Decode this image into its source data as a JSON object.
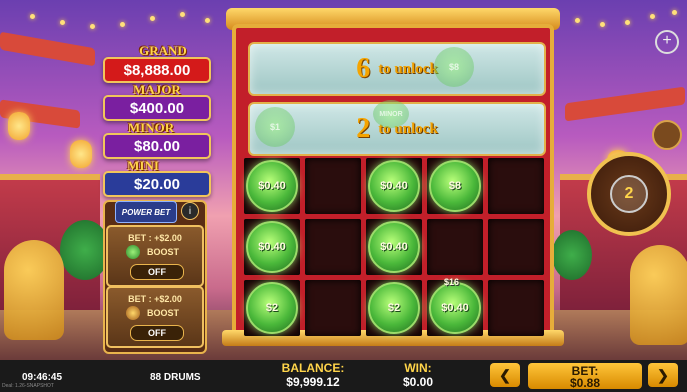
{
  "jackpots": [
    {
      "name": "GRAND",
      "amount": "$8,888.00",
      "color": "#d41a1a"
    },
    {
      "name": "MAJOR",
      "amount": "$400.00",
      "color": "#7a1fa0"
    },
    {
      "name": "MINOR",
      "amount": "$80.00",
      "color": "#7a1fa0"
    },
    {
      "name": "MINI",
      "amount": "$20.00",
      "color": "#2a3c9a"
    }
  ],
  "power_bet": {
    "logo": "POWER BET",
    "info_icon": "info-icon",
    "boosts": [
      {
        "bet": "BET : +$2.00",
        "label": "BOOST",
        "toggle": "OFF"
      },
      {
        "bet": "BET : +$2.00",
        "label": "BOOST",
        "toggle": "OFF"
      }
    ]
  },
  "unlock_rows": [
    {
      "count": "6",
      "text": "to unlock",
      "ghost": "$8"
    },
    {
      "count": "2",
      "text": "to unlock",
      "ghost_left": "$1",
      "ghost_mid": "MINOR"
    }
  ],
  "grid": {
    "rows": [
      [
        "$0.40",
        "",
        "$0.40",
        "$8",
        ""
      ],
      [
        "$0.40",
        "",
        "$0.40",
        "",
        ""
      ],
      [
        "$2",
        "",
        "$2",
        "$0.40",
        ""
      ]
    ],
    "falling_coin": "$16"
  },
  "spin": {
    "remaining": "2"
  },
  "bottom": {
    "time": "09:46:45",
    "drums": "88 DRUMS",
    "balance_label": "BALANCE:",
    "balance_value": "$9,999.12",
    "win_label": "WIN:",
    "win_value": "$0.00",
    "bet_label": "BET:",
    "bet_value": "$0.88",
    "prev_icon": "chevron-left-icon",
    "next_icon": "chevron-right-icon",
    "build_text": "Deal: 1.26-SNAPSHOT"
  }
}
